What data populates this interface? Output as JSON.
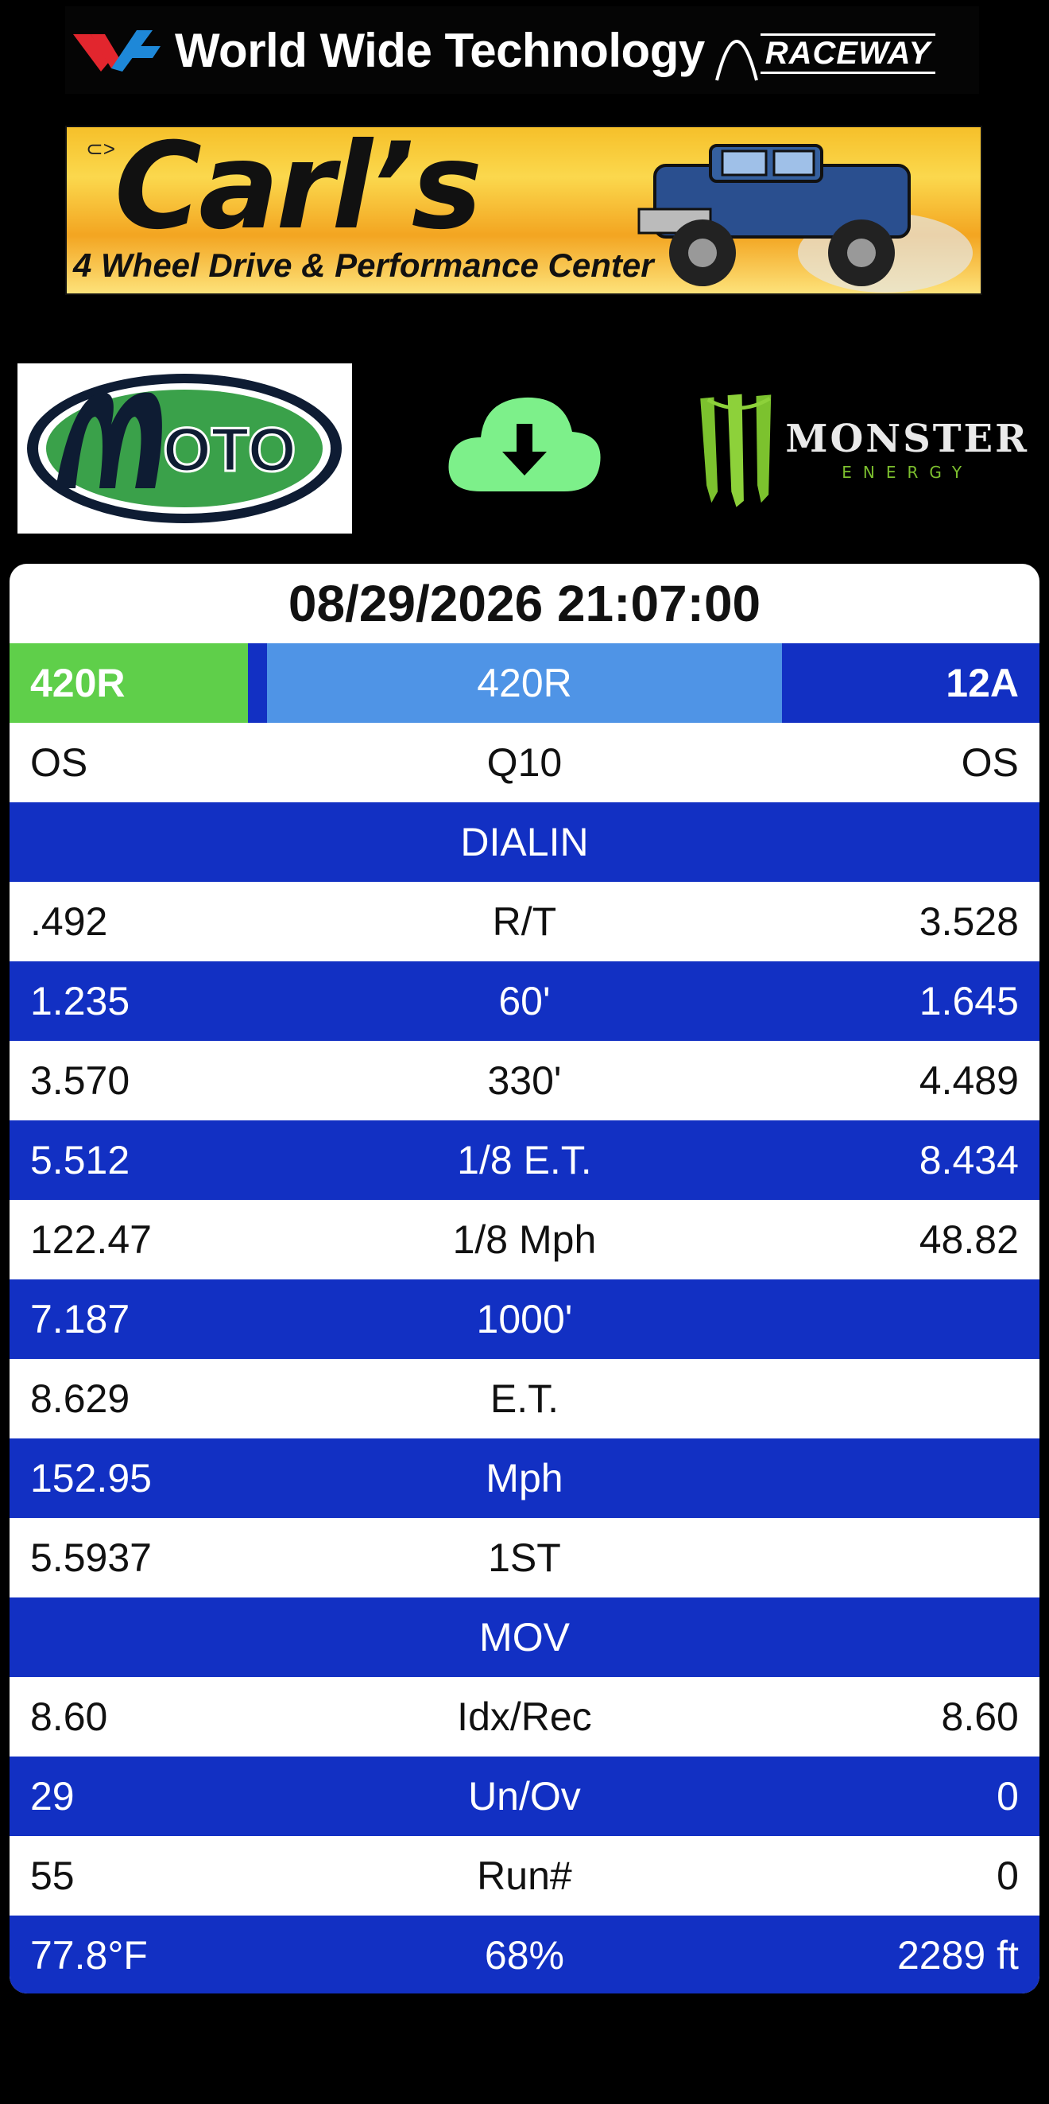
{
  "header": {
    "wwt_title": "World Wide Technology",
    "raceway": "RACEWAY"
  },
  "banner": {
    "name": "Carl’s",
    "subtitle": "4 Wheel Drive & Performance Center"
  },
  "sponsors": {
    "moto": "MOTO",
    "download_icon": "cloud-download-icon",
    "monster_word": "MONSTER",
    "monster_energy": "ENERGY"
  },
  "slip": {
    "datetime": "08/29/2026 21:07:00",
    "lanes": {
      "left": "420R",
      "middle": "420R",
      "right": "12A"
    },
    "rows": [
      {
        "left": "OS",
        "center": "Q10",
        "right": "OS"
      },
      {
        "center": "DIALIN"
      },
      {
        "left": ".492",
        "center": "R/T",
        "right": "3.528"
      },
      {
        "left": "1.235",
        "center": "60'",
        "right": "1.645"
      },
      {
        "left": "3.570",
        "center": "330'",
        "right": "4.489"
      },
      {
        "left": "5.512",
        "center": "1/8 E.T.",
        "right": "8.434"
      },
      {
        "left": "122.47",
        "center": "1/8 Mph",
        "right": "48.82"
      },
      {
        "left": "7.187",
        "center": "1000'",
        "right": ""
      },
      {
        "left": "8.629",
        "center": "E.T.",
        "right": ""
      },
      {
        "left": "152.95",
        "center": "Mph",
        "right": ""
      },
      {
        "left": "5.5937",
        "center": "1ST",
        "right": ""
      },
      {
        "center": "MOV"
      },
      {
        "left": "8.60",
        "center": "Idx/Rec",
        "right": "8.60"
      },
      {
        "left": "29",
        "center": "Un/Ov",
        "right": "0"
      },
      {
        "left": "55",
        "center": "Run#",
        "right": "0"
      },
      {
        "left": "77.8°F",
        "center": "68%",
        "right": "2289 ft"
      }
    ]
  },
  "colors": {
    "blue": "#1230c3",
    "light_blue": "#4f94e6",
    "green": "#5fcf4a",
    "download_green": "#7df08a"
  }
}
